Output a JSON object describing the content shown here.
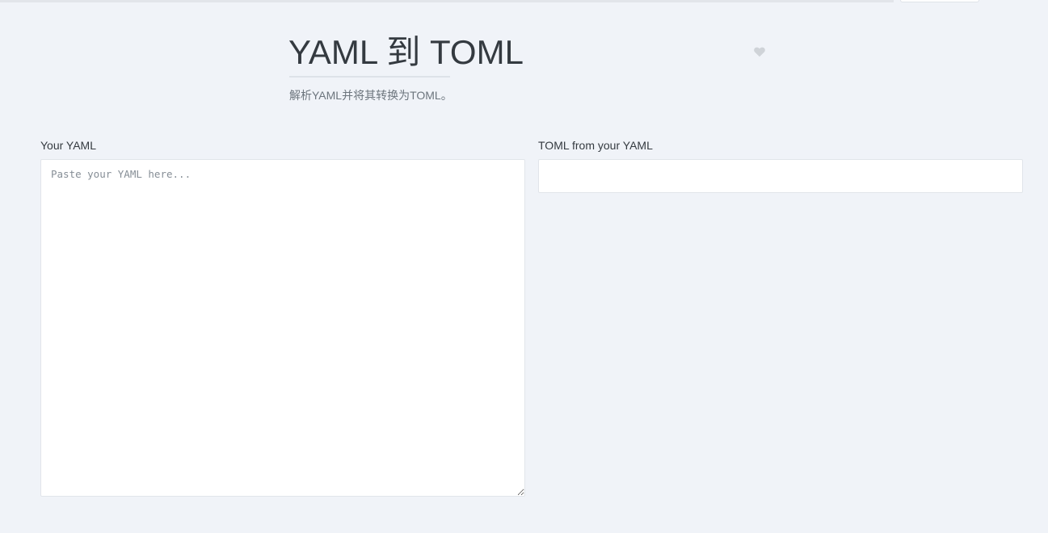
{
  "header": {
    "title": "YAML 到 TOML",
    "subtitle": "解析YAML并将其转换为TOML。",
    "favorite_icon": "heart-icon"
  },
  "input_panel": {
    "label": "Your YAML",
    "placeholder": "Paste your YAML here...",
    "value": ""
  },
  "output_panel": {
    "label": "TOML from your YAML",
    "value": ""
  },
  "colors": {
    "background": "#f0f3f8",
    "heart": "#cfd3d8",
    "title_text": "#343a40",
    "muted_text": "#6c757d"
  }
}
